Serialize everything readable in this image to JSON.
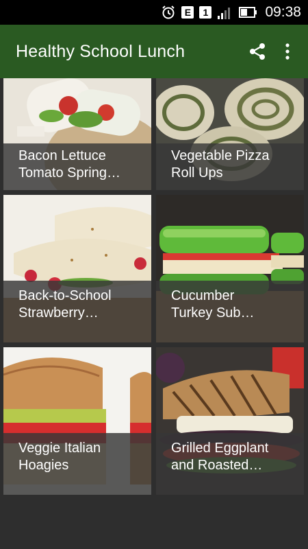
{
  "status_bar": {
    "icons": [
      "alarm-icon",
      "e-badge-icon",
      "sim-1-icon",
      "signal-icon",
      "battery-icon"
    ],
    "e_label": "E",
    "sim_label": "1",
    "time": "09:38"
  },
  "app_bar": {
    "title": "Healthy School Lunch",
    "actions": [
      "share-icon",
      "more-vert-icon"
    ],
    "color": "#2a5a22"
  },
  "recipes": [
    {
      "line1": "Bacon Lettuce",
      "line2": "Tomato Spring…"
    },
    {
      "line1": "Vegetable Pizza",
      "line2": "Roll Ups"
    },
    {
      "line1": "Back-to-School",
      "line2": "Strawberry…"
    },
    {
      "line1": "Cucumber",
      "line2": "Turkey Sub…"
    },
    {
      "line1": "Veggie Italian",
      "line2": "Hoagies"
    },
    {
      "line1": "Grilled Eggplant",
      "line2": "and Roasted…"
    }
  ]
}
